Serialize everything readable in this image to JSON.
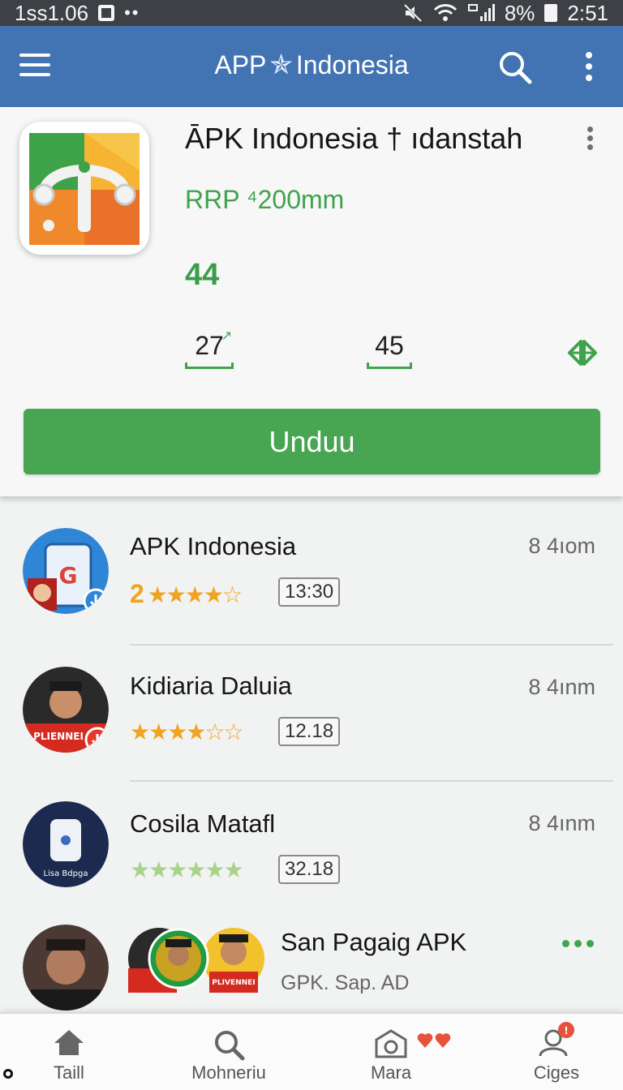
{
  "status_bar": {
    "left_text": "1ss1.06",
    "battery": "8%",
    "time": "2:51"
  },
  "app_bar": {
    "title_left": "APP",
    "title_right": "Indonesia",
    "menu_icon": "menu-icon",
    "search_icon": "search-icon",
    "more_icon": "more-vert-icon",
    "color": "#4273b2"
  },
  "featured": {
    "title": "ĀPK Indonesia † ıdanstah",
    "price": "RRP ⁴200mm",
    "rating": "44",
    "stats": [
      "27",
      "45"
    ],
    "download_label": "Unduu",
    "accent": "#48a652"
  },
  "apps": [
    {
      "name": "APK Indonesia",
      "time": "8 4ıom",
      "rating_prefix": "2",
      "stars": 4,
      "badge": "13:30"
    },
    {
      "name": "Kidiaria Daluia",
      "time": "8 4ınm",
      "rating_prefix": "",
      "stars": 3.5,
      "badge": "12.18"
    },
    {
      "name": "Cosila Matafl",
      "time": "8 4ınm",
      "rating_prefix": "",
      "stars": 5,
      "badge": "32.18"
    },
    {
      "name": "San Pagaig APK",
      "sub": "GPK. Sap. AD"
    }
  ],
  "avatar_texts": {
    "row2_shirt": "PLIENNEI",
    "row3_label": "Lisa Bdpga",
    "row4_shirt": "PLIVENNEI"
  },
  "bottom_nav": [
    {
      "label": "Taill",
      "icon": "home-icon"
    },
    {
      "label": "Mohneriu",
      "icon": "search-icon"
    },
    {
      "label": "Mara",
      "icon": "camera-icon"
    },
    {
      "label": "Ciges",
      "icon": "profile-icon"
    }
  ]
}
